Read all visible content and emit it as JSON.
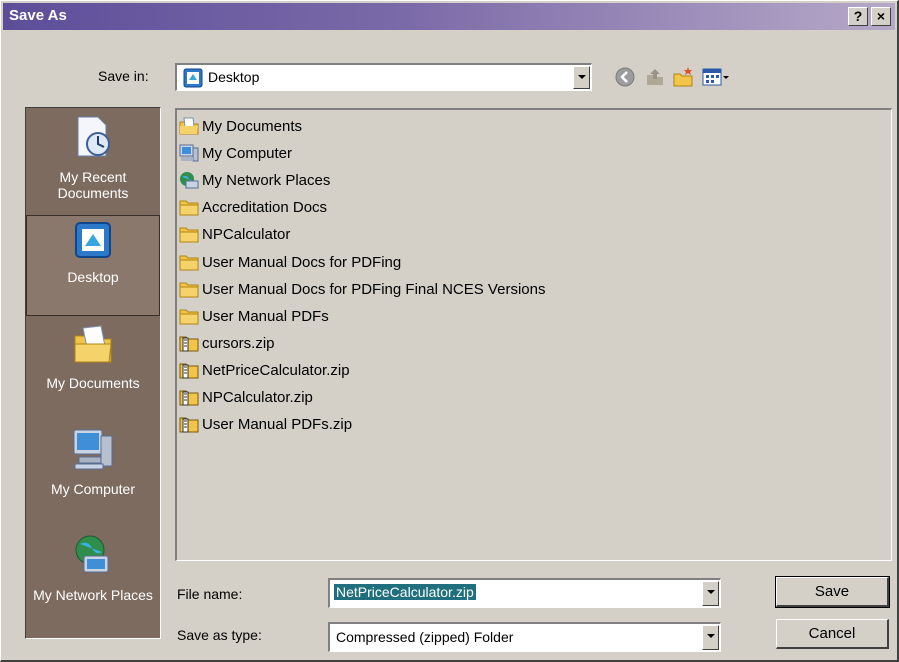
{
  "window": {
    "title": "Save As",
    "help_label": "?",
    "close_label": "×"
  },
  "save_in": {
    "label": "Save in:",
    "value": "Desktop"
  },
  "places": [
    {
      "label": "My Recent Documents",
      "icon": "recent-documents-icon"
    },
    {
      "label": "Desktop",
      "icon": "desktop-icon",
      "selected": true
    },
    {
      "label": "My Documents",
      "icon": "my-documents-icon"
    },
    {
      "label": "My Computer",
      "icon": "my-computer-icon"
    },
    {
      "label": "My Network Places",
      "icon": "network-places-icon"
    }
  ],
  "files": [
    {
      "name": "My Documents",
      "icon": "my-documents-icon"
    },
    {
      "name": "My Computer",
      "icon": "my-computer-icon"
    },
    {
      "name": "My Network Places",
      "icon": "network-places-icon"
    },
    {
      "name": "Accreditation Docs",
      "icon": "folder-icon"
    },
    {
      "name": "NPCalculator",
      "icon": "folder-icon"
    },
    {
      "name": "User Manual Docs for PDFing",
      "icon": "folder-icon"
    },
    {
      "name": "User Manual Docs for PDFing Final NCES Versions",
      "icon": "folder-icon"
    },
    {
      "name": "User Manual PDFs",
      "icon": "folder-icon"
    },
    {
      "name": "cursors.zip",
      "icon": "zip-folder-icon"
    },
    {
      "name": "NetPriceCalculator.zip",
      "icon": "zip-folder-icon"
    },
    {
      "name": "NPCalculator.zip",
      "icon": "zip-folder-icon"
    },
    {
      "name": "User Manual PDFs.zip",
      "icon": "zip-folder-icon"
    }
  ],
  "file_name": {
    "label": "File name:",
    "value": "NetPriceCalculator.zip"
  },
  "save_as_type": {
    "label": "Save as type:",
    "value": "Compressed (zipped) Folder"
  },
  "buttons": {
    "save": "Save",
    "cancel": "Cancel"
  },
  "toolbar": [
    "back-icon",
    "up-folder-icon",
    "new-folder-icon",
    "views-menu-icon"
  ],
  "colors": {
    "title_start": "#5d4e9a",
    "title_end": "#b6a8c8",
    "places_bg": "#7d6b60",
    "selection": "#1f6f7f"
  }
}
